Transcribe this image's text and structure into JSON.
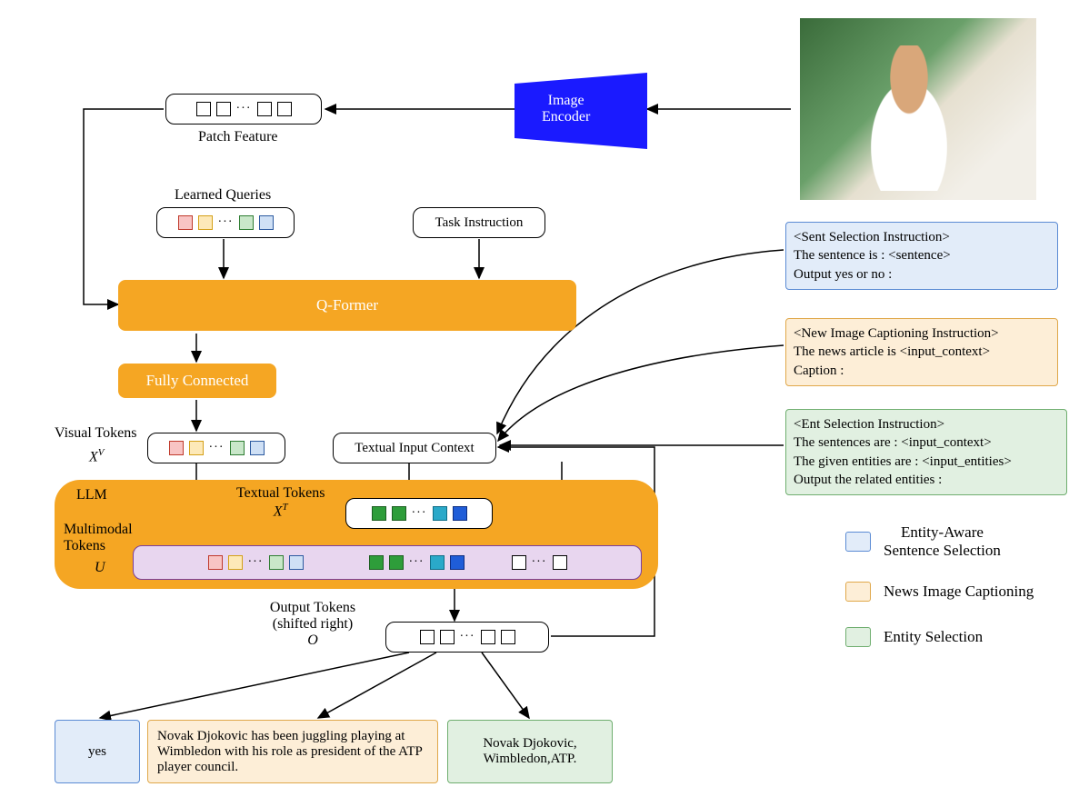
{
  "image_encoder": {
    "label": "Image\nEncoder"
  },
  "patch_feature_label": "Patch Feature",
  "learned_queries_label": "Learned Queries",
  "task_instruction_label": "Task Instruction",
  "qformer_label": "Q-Former",
  "fc_label": "Fully Connected",
  "visual_tokens_label": "Visual Tokens",
  "visual_tokens_var": "X",
  "visual_tokens_sup": "V",
  "textual_input_label": "Textual Input Context",
  "llm": {
    "title": "LLM",
    "textual_tokens_label": "Textual Tokens",
    "textual_tokens_var": "X",
    "textual_tokens_sup": "T",
    "multimodal_label": "Multimodal\nTokens",
    "multimodal_var": "U"
  },
  "output_tokens": {
    "line1": "Output Tokens",
    "line2": "(shifted right)",
    "var": "O"
  },
  "instructions": {
    "sent": {
      "l1": "<Sent Selection Instruction>",
      "l2": "The sentence is : <sentence>",
      "l3": "Output yes or no :"
    },
    "caption": {
      "l1": "<New Image Captioning Instruction>",
      "l2": "The news article is <input_context>",
      "l3": "Caption :"
    },
    "ent": {
      "l1": "<Ent Selection Instruction>",
      "l2": "The sentences are : <input_context>",
      "l3": "The given entities are : <input_entities>",
      "l4": "Output the related entities :"
    }
  },
  "legend": {
    "a": "Entity-Aware\nSentence Selection",
    "b": "News Image Captioning",
    "c": "Entity Selection"
  },
  "outputs": {
    "yes": "yes",
    "caption": "Novak Djokovic has been juggling playing at Wimbledon with his role as president of the ATP player council.",
    "entities": "Novak Djokovic,\nWimbledon,ATP."
  }
}
